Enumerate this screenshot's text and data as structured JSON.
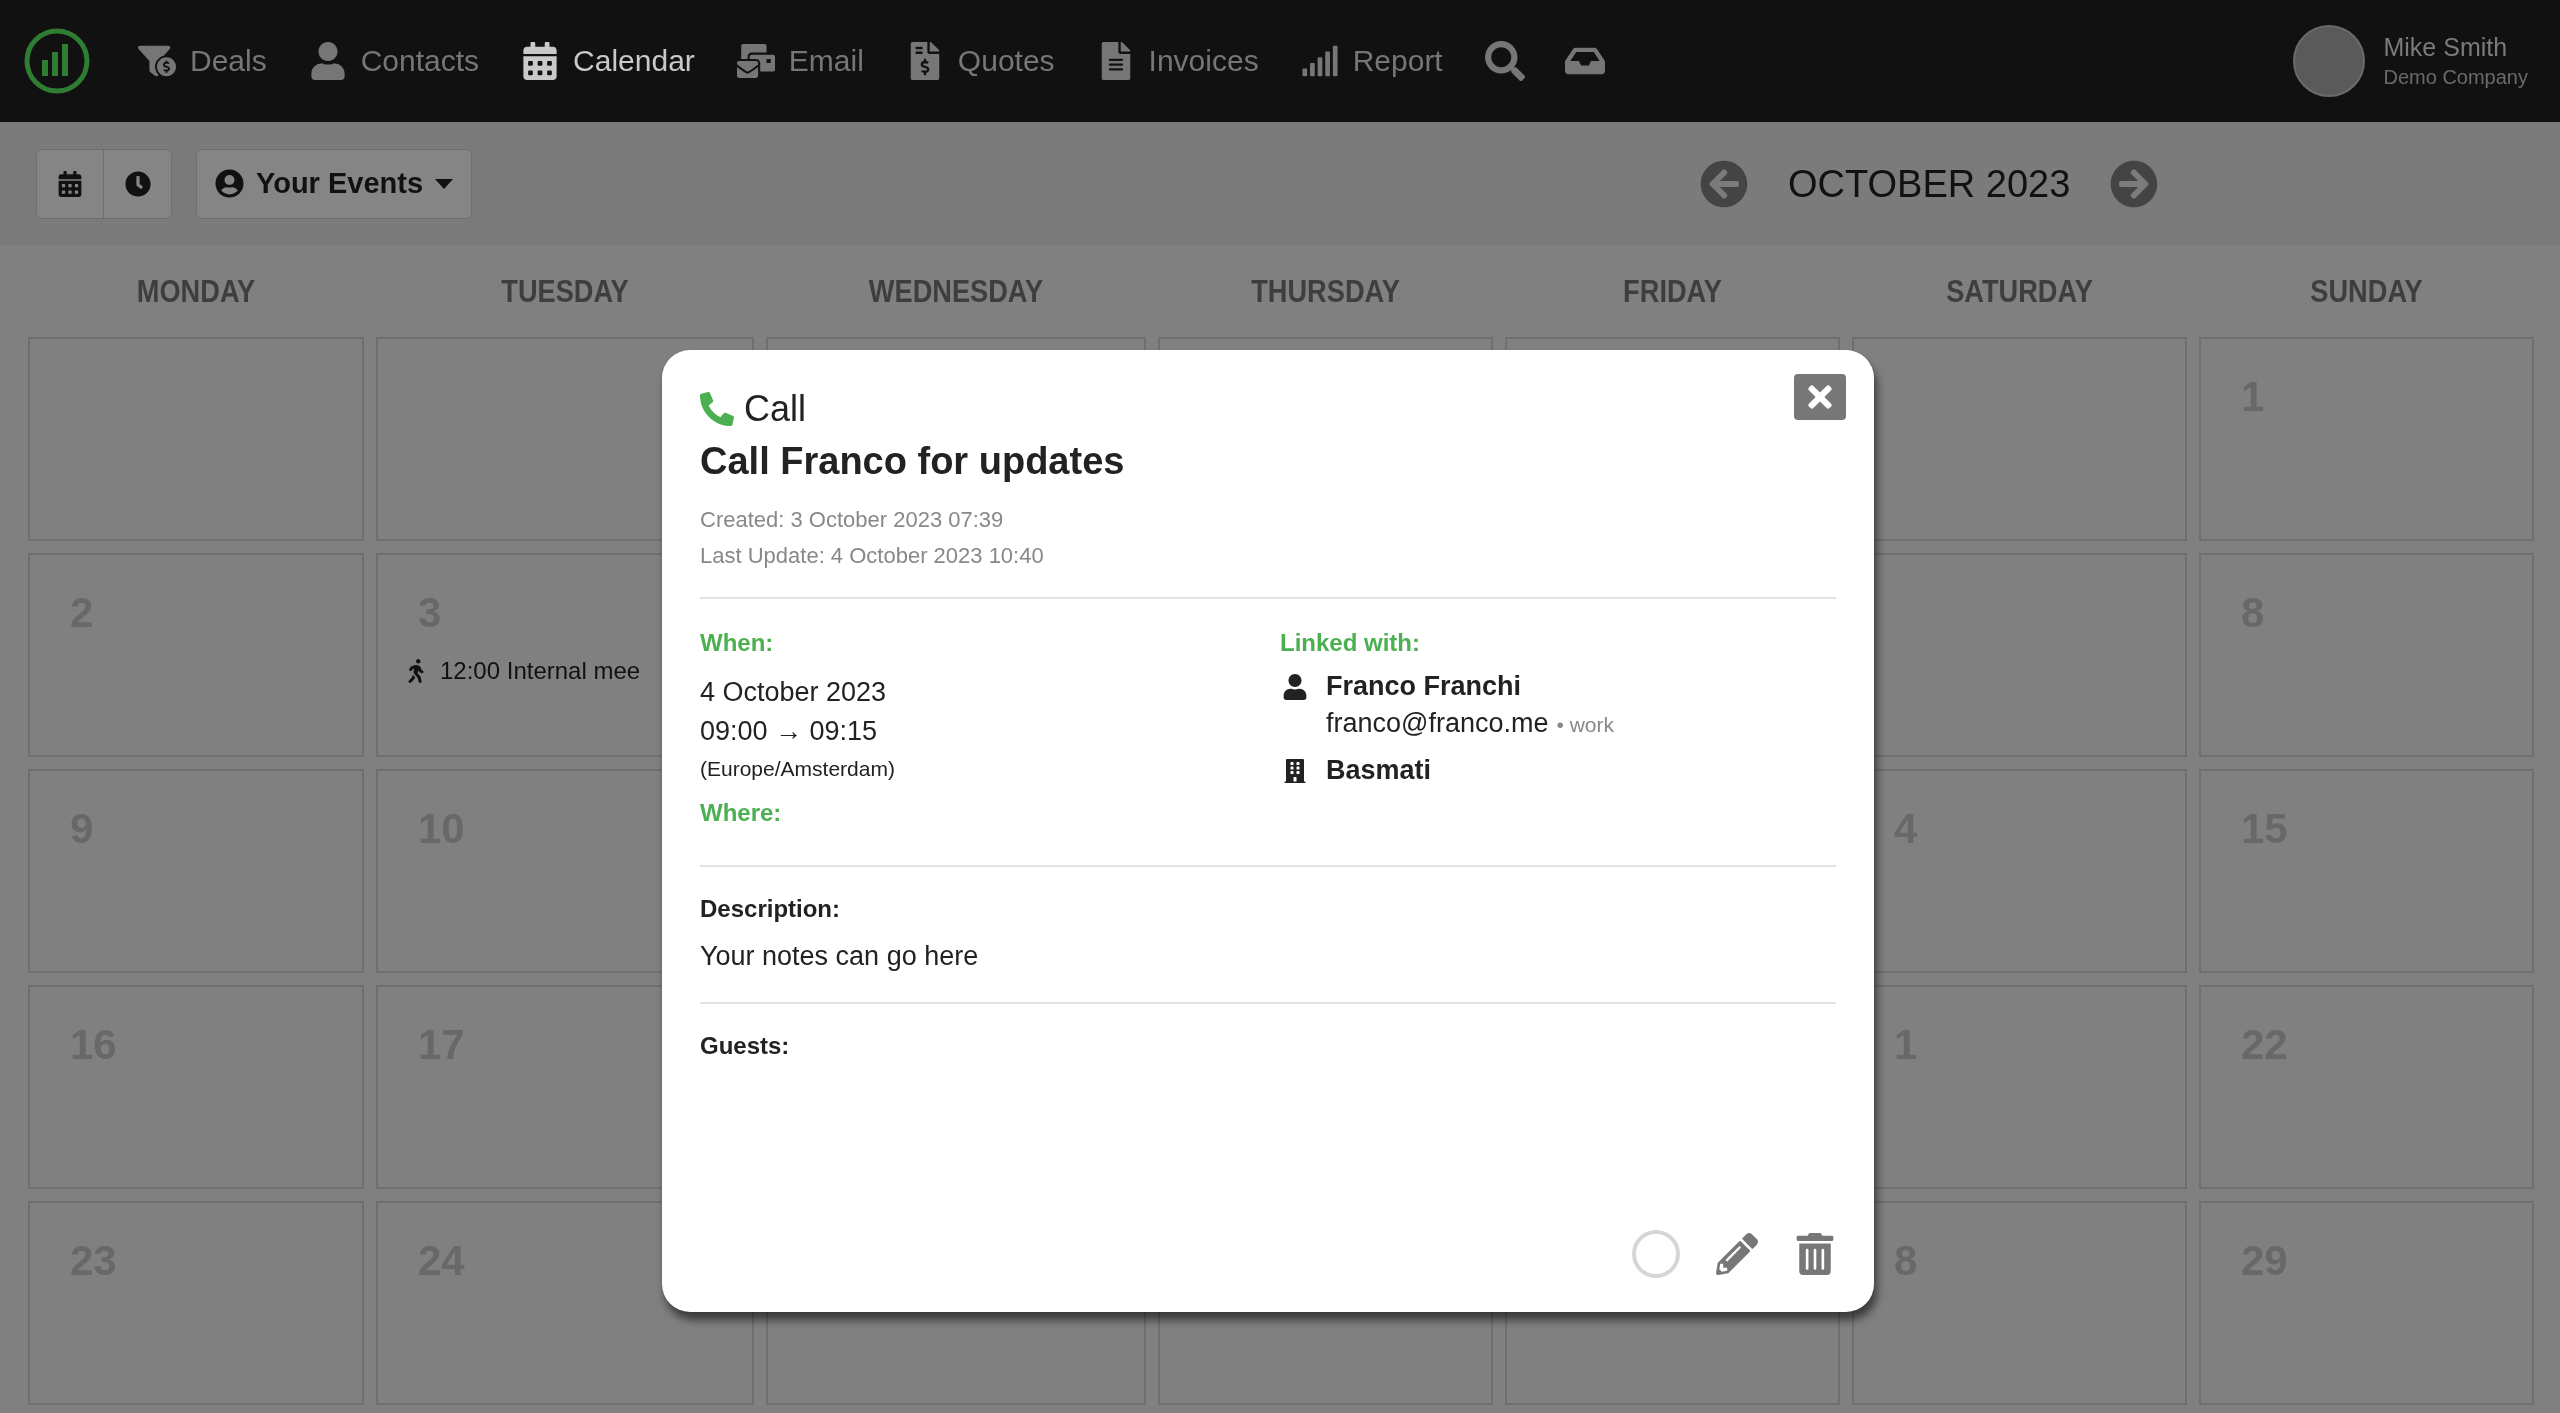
{
  "nav": {
    "items": [
      {
        "label": "Deals",
        "selected": false
      },
      {
        "label": "Contacts",
        "selected": false
      },
      {
        "label": "Calendar",
        "selected": true
      },
      {
        "label": "Email",
        "selected": false
      },
      {
        "label": "Quotes",
        "selected": false
      },
      {
        "label": "Invoices",
        "selected": false
      },
      {
        "label": "Report",
        "selected": false
      }
    ],
    "user": {
      "name": "Mike Smith",
      "company": "Demo Company"
    }
  },
  "toolbar": {
    "filter": "Your Events",
    "month": "OCTOBER 2023"
  },
  "weekdays": [
    "MONDAY",
    "TUESDAY",
    "WEDNESDAY",
    "THURSDAY",
    "FRIDAY",
    "SATURDAY",
    "SUNDAY"
  ],
  "weeks": [
    {
      "sunday": {
        "day": "1"
      }
    },
    {
      "monday": {
        "day": "2"
      },
      "tuesday": {
        "day": "3",
        "events": [
          {
            "kind": "meeting",
            "text": "12:00 Internal mee"
          }
        ]
      },
      "sunday": {
        "day": "8"
      }
    },
    {
      "monday": {
        "day": "9"
      },
      "tuesday": {
        "day": "10"
      },
      "saturday": {
        "day": "4"
      },
      "sunday": {
        "day": "15"
      }
    },
    {
      "monday": {
        "day": "16"
      },
      "tuesday": {
        "day": "17"
      },
      "saturday": {
        "day": "1"
      },
      "sunday": {
        "day": "22"
      }
    },
    {
      "monday": {
        "day": "23"
      },
      "tuesday": {
        "day": "24"
      },
      "saturday": {
        "day": "8"
      },
      "sunday": {
        "day": "29"
      }
    }
  ],
  "modal": {
    "kind": "call",
    "type": "Call",
    "title": "Call Franco for updates",
    "created": "Created: 3 October 2023 07:39",
    "updated": "Last Update: 4 October 2023 10:40",
    "when_label": "When:",
    "date": "4 October 2023",
    "time": "09:00 → 09:15",
    "timezone": "(Europe/Amsterdam)",
    "where_label": "Where:",
    "linked_label": "Linked with:",
    "contact": {
      "name": "Franco Franchi",
      "email": "franco@franco.me",
      "email_tag": "• work"
    },
    "company": "Basmati",
    "description_label": "Description:",
    "description": "Your notes can go here",
    "guests_label": "Guests:",
    "completed": false
  }
}
